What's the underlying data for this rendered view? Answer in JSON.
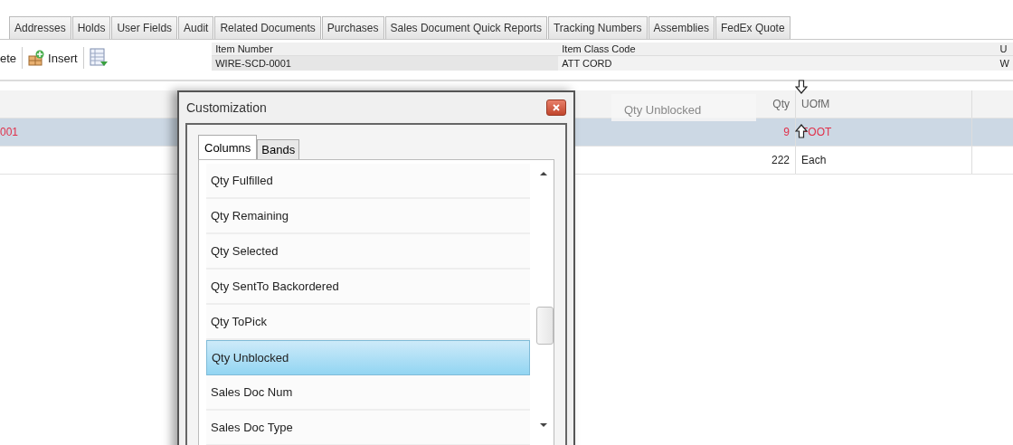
{
  "tabs": [
    {
      "label": "Addresses",
      "selected": false
    },
    {
      "label": "Holds",
      "selected": false
    },
    {
      "label": "User Fields",
      "selected": false
    },
    {
      "label": "Audit",
      "selected": false
    },
    {
      "label": "Related Documents",
      "selected": false
    },
    {
      "label": "Purchases",
      "selected": false
    },
    {
      "label": "Sales Document Quick Reports",
      "selected": false
    },
    {
      "label": "Tracking Numbers",
      "selected": false
    },
    {
      "label": "Assemblies",
      "selected": false
    },
    {
      "label": "FedEx Quote",
      "selected": false
    }
  ],
  "toolbar": {
    "delete_label": "ete",
    "insert_label": "Insert"
  },
  "fields": [
    {
      "label": "Item Number",
      "value": "WIRE-SCD-0001"
    },
    {
      "label": "Item Class Code",
      "value": "ATT CORD"
    },
    {
      "label": "U",
      "value": "W"
    }
  ],
  "grid": {
    "columns": {
      "qty": "Qty",
      "uofm": "UOfM"
    },
    "rows": [
      {
        "item": "001",
        "qty": "9",
        "uofm": "FOOT",
        "selected": true,
        "error": true
      },
      {
        "qty": "222",
        "uofm": "Each",
        "selected": false,
        "error": false
      }
    ]
  },
  "drag_header": "Qty Unblocked",
  "dialog": {
    "title": "Customization",
    "tabs": [
      {
        "label": "Columns",
        "selected": true
      },
      {
        "label": "Bands",
        "selected": false
      }
    ],
    "items": [
      {
        "label": "Qty Fulfilled",
        "selected": false
      },
      {
        "label": "Qty Remaining",
        "selected": false
      },
      {
        "label": "Qty Selected",
        "selected": false
      },
      {
        "label": "Qty SentTo Backordered",
        "selected": false
      },
      {
        "label": "Qty ToPick",
        "selected": false
      },
      {
        "label": "Qty Unblocked",
        "selected": true
      },
      {
        "label": "Sales Doc Num",
        "selected": false
      },
      {
        "label": "Sales Doc Type",
        "selected": false
      }
    ]
  }
}
